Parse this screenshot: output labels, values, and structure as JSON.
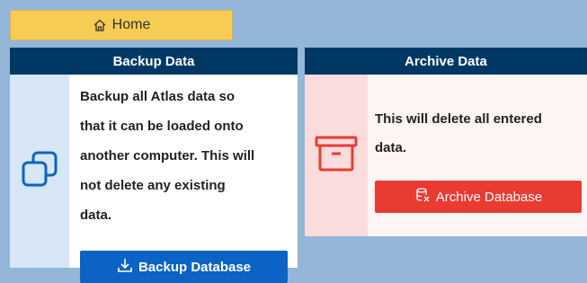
{
  "home": {
    "label": "Home",
    "icon": "home-icon"
  },
  "backup": {
    "title": "Backup Data",
    "description_lines": [
      "Backup all Atlas data so",
      "that it can be loaded onto",
      "another computer. This will",
      "not delete any existing",
      "data."
    ],
    "button_label": "Backup Database",
    "button_icon": "download-icon",
    "panel_icon": "copy-icon"
  },
  "archive": {
    "title": "Archive Data",
    "description_lines": [
      "This will delete all entered",
      "data."
    ],
    "button_label": "Archive Database",
    "button_icon": "delete-database-icon",
    "panel_icon": "archive-box-icon"
  },
  "colors": {
    "header": "#003865",
    "home_button": "#f7cc55",
    "backup_button": "#0b63c5",
    "archive_button": "#ea3b32",
    "background": "#93b6d9"
  }
}
